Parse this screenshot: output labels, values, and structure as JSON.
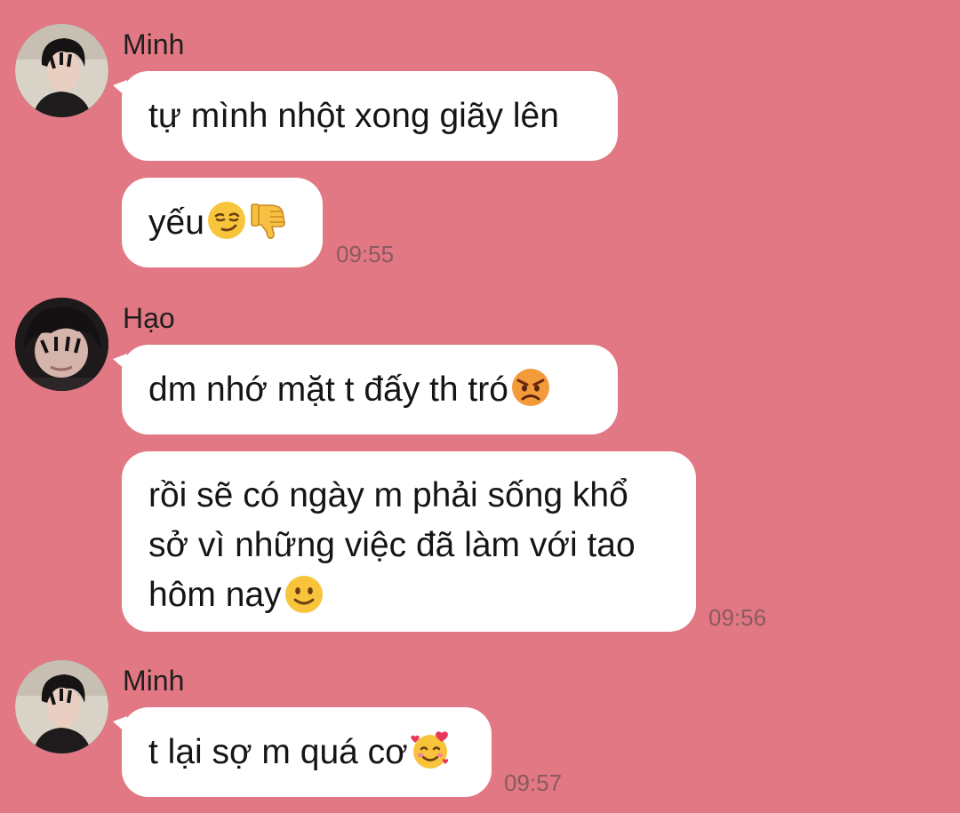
{
  "colors": {
    "background": "#e27883",
    "bubble": "#ffffff",
    "text": "#151515",
    "timestamp": "#8a5a60"
  },
  "messages": [
    {
      "sender": "Minh",
      "avatar_icon": "avatar-minh",
      "bubbles": [
        {
          "text": "tự mình nhột xong giãy lên",
          "emoji": []
        },
        {
          "text": "yếu",
          "emoji": [
            "smirking-face-emoji",
            "thumbs-down-emoji"
          ],
          "time": "09:55"
        }
      ]
    },
    {
      "sender": "Hạo",
      "avatar_icon": "avatar-hao",
      "bubbles": [
        {
          "text": "dm nhớ mặt t đấy th tró",
          "emoji": [
            "angry-face-emoji"
          ]
        },
        {
          "lines": [
            "rồi sẽ có ngày m phải sống khổ",
            "sở vì những việc đã làm với tao",
            "hôm nay"
          ],
          "emoji": [
            "slightly-smiling-face-emoji"
          ],
          "time": "09:56"
        }
      ]
    },
    {
      "sender": "Minh",
      "avatar_icon": "avatar-minh",
      "bubbles": [
        {
          "text": "t lại sợ m quá cơ",
          "emoji": [
            "smiling-face-with-hearts-emoji"
          ],
          "time": "09:57"
        }
      ]
    }
  ]
}
